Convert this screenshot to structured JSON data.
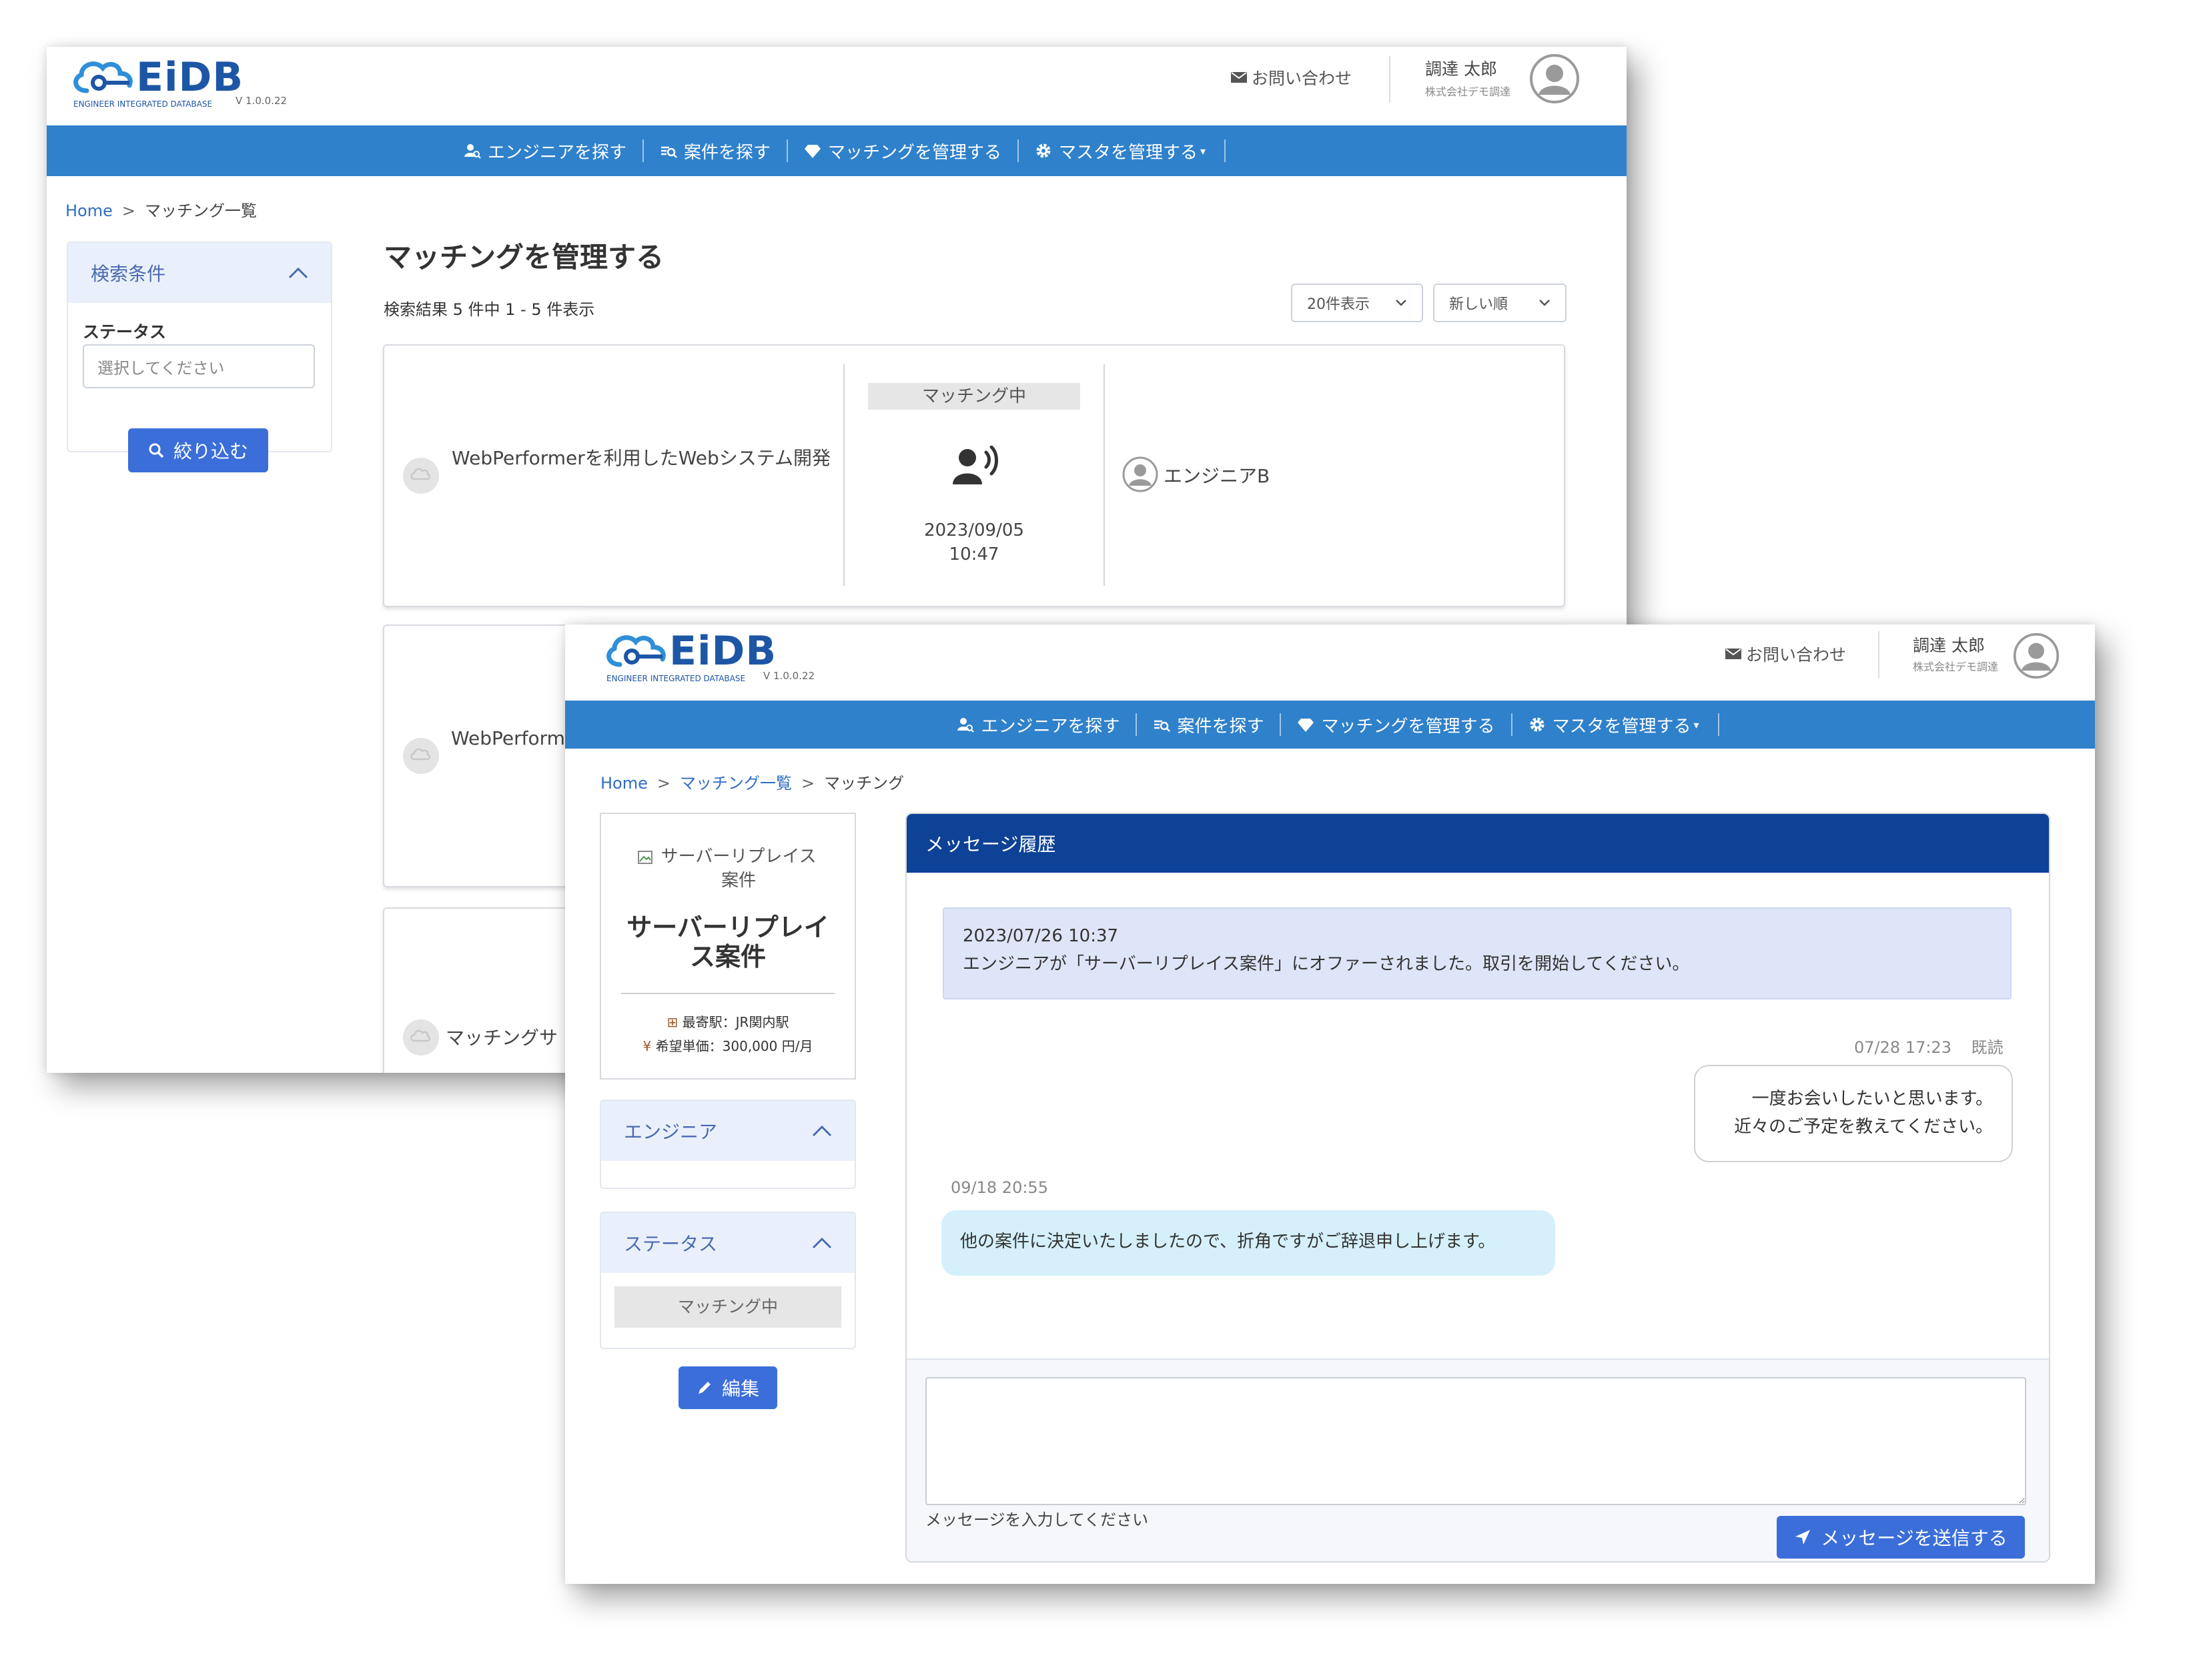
{
  "brand": {
    "name": "EiDB",
    "subtitle": "ENGINEER INTEGRATED DATABASE",
    "version": "V 1.0.0.22",
    "color": "#1d56a5"
  },
  "header": {
    "contact": "お問い合わせ",
    "user_name": "調達 太郎",
    "company": "株式会社デモ調達"
  },
  "nav": {
    "items": [
      {
        "label": "エンジニアを探す",
        "icon": "engineer-search-icon"
      },
      {
        "label": "案件を探す",
        "icon": "project-search-icon"
      },
      {
        "label": "マッチングを管理する",
        "icon": "diamond-icon"
      },
      {
        "label": "マスタを管理する",
        "icon": "gear-icon",
        "caret": "▾"
      }
    ],
    "color": "#2f81cb"
  },
  "list_page": {
    "breadcrumb": {
      "home": "Home",
      "sep": ">",
      "current": "マッチング一覧"
    },
    "search_panel": {
      "title": "検索条件",
      "status_label": "ステータス",
      "status_placeholder": "選択してください",
      "filter_button": "絞り込む"
    },
    "title": "マッチングを管理する",
    "result_count": "検索結果 5 件中 1 - 5 件表示",
    "page_size": "20件表示",
    "sort": "新しい順",
    "cards": [
      {
        "project": "WebPerformerを利用したWebシステム開発",
        "status": "マッチング中",
        "date": "2023/09/05",
        "time": "10:47",
        "engineer": "エンジニアB"
      },
      {
        "project": "WebPerform"
      },
      {
        "project": "マッチングサ"
      }
    ]
  },
  "detail_page": {
    "breadcrumb": {
      "home": "Home",
      "sep": ">",
      "list": "マッチング一覧",
      "current": "マッチング"
    },
    "project": {
      "image_alt": "サーバーリプレイス案件",
      "title": "サーバーリプレイス案件",
      "station": "最寄駅：JR関内駅",
      "price": "希望単価：300,000 円/月"
    },
    "engineer_panel": {
      "title": "エンジニア"
    },
    "status_panel": {
      "title": "ステータス",
      "value": "マッチング中"
    },
    "edit_button": "編集",
    "messages": {
      "title": "メッセージ履歴",
      "system": {
        "datetime": "2023/07/26 10:37",
        "text": "エンジニアが「サーバーリプレイス案件」にオファーされました。取引を開始してください。"
      },
      "sent": {
        "datetime": "07/28 17:23",
        "read": "既読",
        "line1": "一度お会いしたいと思います。",
        "line2": "近々のご予定を教えてください。"
      },
      "received": {
        "datetime": "09/18 20:55",
        "text": "他の案件に決定いたしましたので、折角ですがご辞退申し上げます。"
      },
      "input_placeholder": "メッセージを入力してください",
      "send_button": "メッセージを送信する",
      "header_color": "#0d4296"
    }
  }
}
